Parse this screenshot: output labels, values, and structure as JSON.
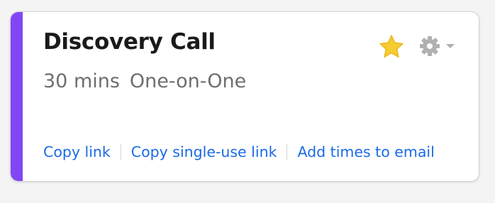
{
  "event": {
    "title": "Discovery Call",
    "duration": "30 mins",
    "type": "One-on-One"
  },
  "accent_color": "#8247f5",
  "link_color": "#1a6ae6",
  "star_color": "#f6cc33",
  "icons": {
    "favorite": "star-icon",
    "settings": "gear-icon",
    "menu": "caret-down-icon"
  },
  "actions": [
    {
      "label": "Copy link"
    },
    {
      "label": "Copy single-use link"
    },
    {
      "label": "Add times to email"
    }
  ]
}
